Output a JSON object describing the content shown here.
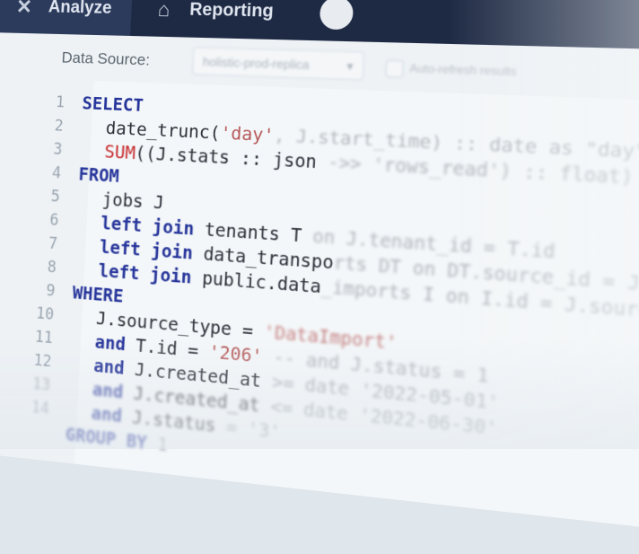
{
  "nav": {
    "analyze_label": "Analyze",
    "reporting_label": "Reporting"
  },
  "toolbar": {
    "data_source_label": "Data Source:",
    "data_source_value": "holistic-prod-replica",
    "option_label": "Auto-refresh results"
  },
  "editor": {
    "line_numbers": [
      "1",
      "2",
      "3",
      "4",
      "5",
      "6",
      "7",
      "8",
      "9",
      "10",
      "11",
      "12",
      "13",
      "14"
    ],
    "l1_kw": "SELECT",
    "l2_fn": "date_trunc(",
    "l2_str": "'day'",
    "l2_rest": ", J.start_time) :: date as \"day\"",
    "l3_fn": "SUM",
    "l3_rest": "((J.stats :: json",
    "l3_faded": " ->> 'rows_read') :: float) as \"rows read total\"",
    "l4_kw": "FROM",
    "l5_text": "jobs J",
    "l6_kw": "left join",
    "l6_text": " tenants T",
    "l6_faded": " on J.tenant_id = T.id",
    "l7_kw": "left join",
    "l7_text": " data_transpo",
    "l7_faded": "rts DT on DT.source_id = J.id",
    "l8_kw": "left join",
    "l8_text": " public.data",
    "l8_faded": "_imports I on I.id = J.source_id",
    "l9_kw": "WHERE",
    "l10_text": "J.source_type = ",
    "l10_str": "'DataImport'",
    "l11_kw": "and",
    "l11_text": " T.id = ",
    "l11_str": "'206'",
    "l11_faded": " -- and J.status = 1",
    "l12_kw": "and",
    "l12_text": " J.created_at",
    "l12_faded": " >= date '2022-05-01'",
    "l13_kw": "and",
    "l13_text": " J.created_at",
    "l13_faded": " <= date '2022-06-30'",
    "l14_kw": "and",
    "l14_text": " J.status",
    "l14_faded": " = '3'",
    "l15_kw": "GROUP BY",
    "l15_text": " 1"
  }
}
